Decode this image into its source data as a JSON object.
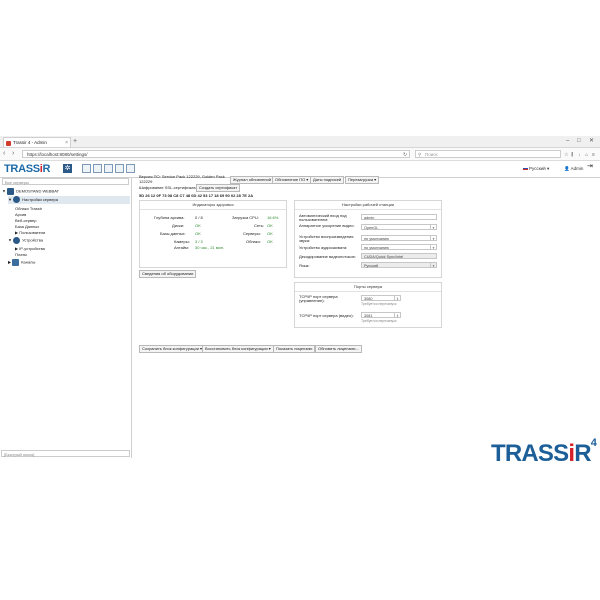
{
  "browser": {
    "tab_title": "Trassir 4 - Admin",
    "new_tab": "+",
    "url": "https://localhost:8080/settings/",
    "search_placeholder": "Поиск",
    "win_min": "–",
    "win_max": "□",
    "win_close": "✕"
  },
  "header": {
    "logo_a": "TRASS",
    "logo_b": "i",
    "logo_c": "R",
    "language": "Русский",
    "user": "Admin"
  },
  "sidebar": {
    "filter_placeholder": "Все серверы",
    "items": [
      {
        "label": "DEMOSTAND WEBBAT"
      },
      {
        "label": "Настройки сервера"
      },
      {
        "label": "Облако Trassir"
      },
      {
        "label": "Архив"
      },
      {
        "label": "Веб-сервер"
      },
      {
        "label": "База Данных"
      },
      {
        "label": "▶ Пользователи"
      },
      {
        "label": "Устройства"
      },
      {
        "label": "▶ IP-устройства"
      },
      {
        "label": "Платы"
      },
      {
        "label": "Каналы"
      }
    ],
    "bottom_filter": "[Быстрый поиск]"
  },
  "main": {
    "version_line_1": "Версия ПО: Service Pack 122229, Golden Pack",
    "version_line_2": "122229",
    "buttons_top": [
      "Журнал обновлений",
      "Обновление ПО ▾",
      "Даты подписей",
      "Перезагрузка ▾"
    ],
    "ssl_label": "Шифрование SSL-сертификата",
    "ssl_button": "Создать сертификат",
    "hash": "5D 26 12 0F 73 08 C8 C7 48 0D 42 53 17 18 69 90 02 28 7E 2A",
    "health": {
      "title": "Индикаторы здоровья",
      "rows": [
        {
          "l1": "Глубина архива:",
          "v1": "0 / 8",
          "l2": "Загрузка CPU:",
          "v2": "16.6%"
        },
        {
          "l1": "Диски:",
          "v1": "OK",
          "l2": "Сеть:",
          "v2": "OK"
        },
        {
          "l1": "Базы данных:",
          "v1": "OK",
          "l2": "Серверы:",
          "v2": "OK"
        },
        {
          "l1": "Камеры:",
          "v1": "3 / 3",
          "l2": "Облако:",
          "v2": "OK"
        },
        {
          "l1": "Аптайм:",
          "v1": "30 час., 21 мин.",
          "l2": "",
          "v2": ""
        }
      ]
    },
    "hw_button": "Сведения об оборудовании",
    "workplace": {
      "title": "Настройки рабочей станции",
      "rows": [
        {
          "label": "Автоматический вход под пользователем:",
          "value": "admin"
        },
        {
          "label": "Аппаратное ускорение видео:",
          "value": "OpenGL"
        },
        {
          "label": "Устройство воспроизведения звука:",
          "value": "по умолчанию"
        },
        {
          "label": "Устройство аудиозахвата:",
          "value": "по умолчанию"
        },
        {
          "label": "Декодирование видеопотоков:",
          "value": "CUDA/Quick Sync/Intel"
        },
        {
          "label": "Язык:",
          "value": "Русский"
        }
      ]
    },
    "ports": {
      "title": "Порты сервера",
      "rows": [
        {
          "label": "TCP/IP порт сервера (управление):",
          "value": "3080",
          "hint": "Требуется перезапуск"
        },
        {
          "label": "TCP/IP порт сервера (видео):",
          "value": "3081",
          "hint": "Требуется перезапуск"
        }
      ]
    },
    "buttons_bottom": [
      "Сохранить блок конфигурации ▾",
      "Восстановить блок конфигурации ▾",
      "Показать лицензию",
      "Обновить лицензию..."
    ]
  },
  "footer_logo": {
    "a": "TRASS",
    "b": "i",
    "c": "R",
    "sup": "4"
  },
  "colors": {
    "brand_blue": "#1c5f98",
    "brand_red": "#d42027",
    "ok_green": "#2e8b2e"
  }
}
